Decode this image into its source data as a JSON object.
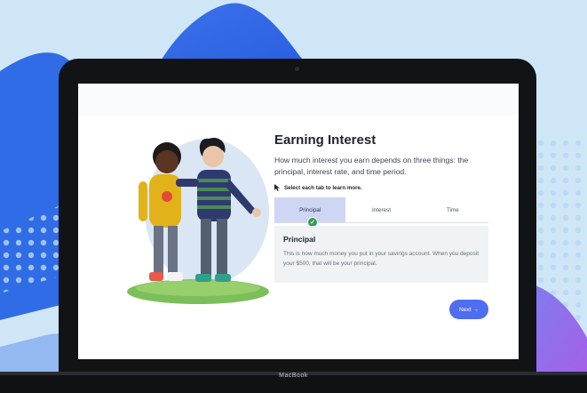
{
  "page": {
    "title": "Earning Interest",
    "intro": "How much interest you earn depends on three things: the principal, interest rate, and time period.",
    "hint": "Select each tab to learn more."
  },
  "tabs": [
    {
      "label": "Principal",
      "active": true,
      "completed": true
    },
    {
      "label": "Interest",
      "active": false
    },
    {
      "label": "Time",
      "active": false
    }
  ],
  "panel": {
    "title": "Principal",
    "text": "This is how much money you put in your savings account. When you deposit your $500, that will be your principal."
  },
  "next_button": {
    "label": "Next →"
  },
  "device": {
    "brand": "MacBook"
  },
  "colors": {
    "accent": "#4f6df0",
    "tab_active": "#cfd6f3",
    "check": "#2f9e57",
    "background": "#cfe6f7"
  }
}
